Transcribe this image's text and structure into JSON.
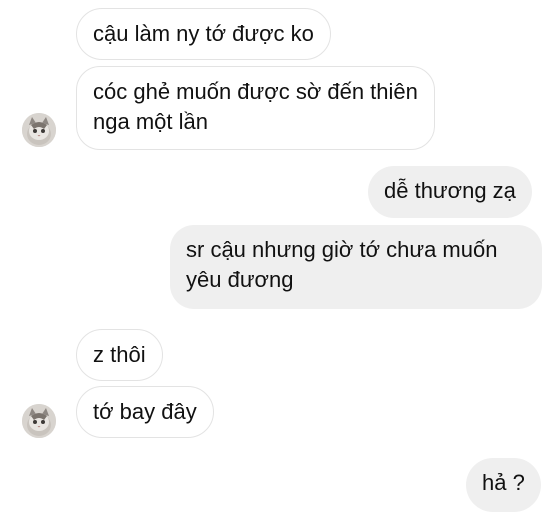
{
  "conversation": {
    "messages": [
      {
        "side": "incoming",
        "text": "cậu làm ny tớ được ko"
      },
      {
        "side": "incoming",
        "line1": "cóc ghẻ muốn được sờ đến thiên",
        "line2": "nga một lần"
      },
      {
        "side": "outgoing",
        "text": "dễ thương zạ"
      },
      {
        "side": "outgoing",
        "line1": "sr cậu nhưng giờ tớ chưa muốn",
        "line2": "yêu đương"
      },
      {
        "side": "incoming",
        "text": "z thôi"
      },
      {
        "side": "incoming",
        "text": "tớ bay đây"
      },
      {
        "side": "outgoing",
        "text": "hả ?"
      }
    ]
  },
  "colors": {
    "incoming_bubble": "#ffffff",
    "incoming_border": "#e3e3e3",
    "outgoing_bubble": "#efefef",
    "text": "#111111"
  },
  "icons": {
    "avatar": "cat-avatar-icon"
  }
}
